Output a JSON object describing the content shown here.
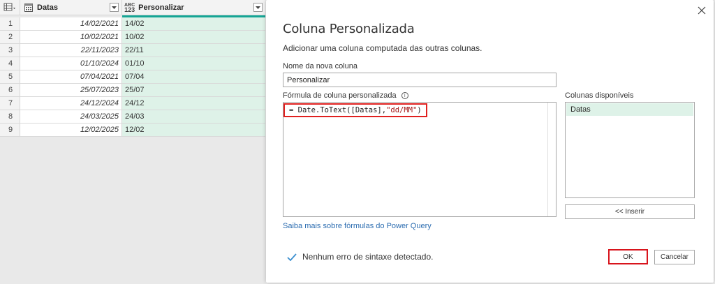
{
  "grid": {
    "columns": [
      {
        "name": "Datas",
        "type_icon": "calendar-icon"
      },
      {
        "name": "Personalizar",
        "type_icon": "any-type-icon",
        "type_text_top": "ABC",
        "type_text_bottom": "123"
      }
    ],
    "rows": [
      {
        "n": "1",
        "date": "14/02/2021",
        "pers": "14/02"
      },
      {
        "n": "2",
        "date": "10/02/2021",
        "pers": "10/02"
      },
      {
        "n": "3",
        "date": "22/11/2023",
        "pers": "22/11"
      },
      {
        "n": "4",
        "date": "01/10/2024",
        "pers": "01/10"
      },
      {
        "n": "5",
        "date": "07/04/2021",
        "pers": "07/04"
      },
      {
        "n": "6",
        "date": "25/07/2023",
        "pers": "25/07"
      },
      {
        "n": "7",
        "date": "24/12/2024",
        "pers": "24/12"
      },
      {
        "n": "8",
        "date": "24/03/2025",
        "pers": "24/03"
      },
      {
        "n": "9",
        "date": "12/02/2025",
        "pers": "12/02"
      }
    ]
  },
  "dialog": {
    "title": "Coluna Personalizada",
    "subtitle": "Adicionar uma coluna computada das outras colunas.",
    "new_column_label": "Nome da nova coluna",
    "new_column_value": "Personalizar",
    "formula_label": "Fórmula de coluna personalizada",
    "formula_prefix": "= Date.ToText([Datas],",
    "formula_string": "\"dd/MM\"",
    "formula_suffix": ")",
    "available_columns_label": "Colunas disponíveis",
    "available_columns": [
      "Datas"
    ],
    "insert_button": "<< Inserir",
    "learn_more_link": "Saiba mais sobre fórmulas do Power Query",
    "status_text": "Nenhum erro de sintaxe detectado.",
    "ok_button": "OK",
    "cancel_button": "Cancelar"
  },
  "colors": {
    "teal": "#15a595",
    "selected_green": "#def2e8",
    "highlight_red": "#e0201f",
    "status_check": "#3c8fcf"
  }
}
